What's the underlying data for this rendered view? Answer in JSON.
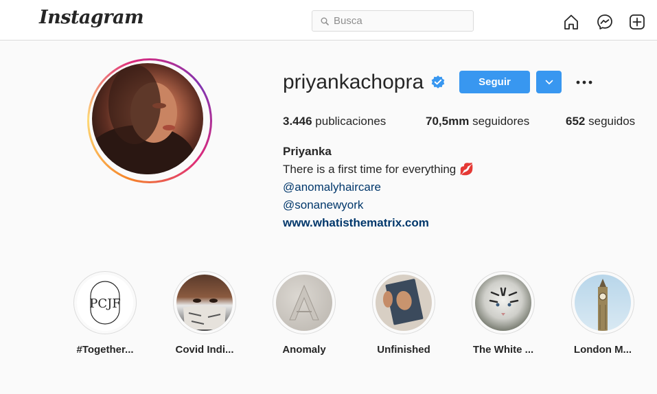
{
  "header": {
    "logo": "Instagram",
    "search_placeholder": "Busca",
    "nav_icons": [
      "home-icon",
      "messenger-icon",
      "new-post-icon"
    ]
  },
  "profile": {
    "username": "priyankachopra",
    "verified": true,
    "follow_label": "Seguir",
    "stats": {
      "posts_count": "3.446",
      "posts_label": "publicaciones",
      "followers_count": "70,5mm",
      "followers_label": "seguidores",
      "following_count": "652",
      "following_label": "seguidos"
    },
    "bio": {
      "name": "Priyanka",
      "line1": "There is a first time for everything",
      "line1_emoji": "💋",
      "mention1": "@anomalyhaircare",
      "mention2": "@sonanewyork",
      "website": "www.whatisthematrix.com"
    }
  },
  "highlights": [
    {
      "label": "#Together...",
      "logo_text": "PCJF"
    },
    {
      "label": "Covid Indi..."
    },
    {
      "label": "Anomaly",
      "logo_text": "A"
    },
    {
      "label": "Unfinished"
    },
    {
      "label": "The White ..."
    },
    {
      "label": "London M..."
    }
  ],
  "colors": {
    "accent": "#3897f0",
    "link": "#00376b",
    "text": "#262626",
    "muted": "#8e8e8e",
    "background": "#fafafa",
    "border": "#dbdbdb"
  }
}
